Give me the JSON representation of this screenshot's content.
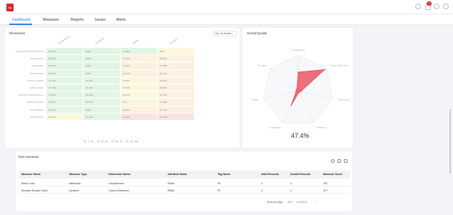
{
  "header": {
    "logo_text": "DQ",
    "notification_count": "3"
  },
  "tabs": [
    {
      "label": "Dashboard"
    },
    {
      "label": "Measures"
    },
    {
      "label": "Reports"
    },
    {
      "label": "Issues"
    },
    {
      "label": "Alerts"
    }
  ],
  "dimensions_card": {
    "title": "Dimensions",
    "select_value": "Top 10 Assets",
    "columns": [
      "Completeness",
      "Conformity",
      "Validity",
      "Accuracy"
    ],
    "rows": [
      {
        "label": "BANKEXPOSUREPOSITION",
        "values": [
          "96.09%",
          "100%",
          "76.59%",
          "68%"
        ]
      },
      {
        "label": "BANKLOANS",
        "values": [
          "86.58%",
          "100%",
          "41.18%",
          "38.55%"
        ]
      },
      {
        "label": "BRANCHES",
        "values": [
          "86.59%",
          "100%",
          "41.18%",
          "41.65%"
        ]
      },
      {
        "label": "BRANCHES2",
        "values": [
          "88.57%",
          "100%",
          "42.12%",
          "40.21%"
        ]
      },
      {
        "label": "LOANS_ORDER",
        "values": [
          "79.74%",
          "96.32%",
          "74.59%",
          "38.15%"
        ]
      },
      {
        "label": "EMPLOYEES",
        "values": [
          "77.74%",
          "96.32%",
          "72.50%",
          "38.85%"
        ]
      },
      {
        "label": "MORTGAGEPORTFOLIO",
        "values": [
          "79.82%",
          "95.90%",
          "50.00%",
          "31.45%"
        ]
      },
      {
        "label": "TRANSACTIONS",
        "values": [
          "79.82%",
          "95.92%",
          "57%",
          "27.50%"
        ]
      },
      {
        "label": "CUSTOMERS",
        "values": [
          "78.73%",
          "100%",
          "49.80%",
          "25.10%"
        ]
      },
      {
        "label": "PORTFOLIOS",
        "values": [
          "64.44%",
          "97.45%",
          "19.23%",
          "15.72%"
        ]
      }
    ],
    "legend": [
      {
        "label": "0 - 25",
        "color": "#fbe3e3"
      },
      {
        "label": "25 - 50",
        "color": "#fdf0e0"
      },
      {
        "label": "50 - 75",
        "color": "#fbf7df"
      },
      {
        "label": "75 - 100",
        "color": "#e2f5e4"
      }
    ]
  },
  "quality_card": {
    "title": "Overall Quality",
    "value": "47.4%",
    "axes": [
      "Completeness",
      "Custom Dimension",
      "Consistency",
      "Timeliness",
      "Uniqueness",
      "Validity",
      "Accuracy"
    ],
    "scores": [
      0.52,
      0.95,
      0.08,
      0.05,
      0.45,
      0.06,
      0.05
    ],
    "accent": "#e8414d"
  },
  "rules_card": {
    "title": "Rule Summary",
    "columns": [
      "Measure Name",
      "Measure Type",
      "Dimension Name",
      "Attribute Name",
      "Tag Name",
      "Valid Records",
      "Invalid Records",
      "Measure Score"
    ],
    "rows": [
      [
        "Blank Count",
        "distribution",
        "Completeness",
        "EMAIL",
        "PII",
        "4",
        "4",
        "100"
      ],
      [
        "Business Domain Check",
        "semantic",
        "Custom Dimension",
        "EMAIL",
        "PII",
        "4",
        "4",
        "29.7"
      ]
    ],
    "pager": {
      "rows_label": "Rows per page:",
      "rows_value": "10",
      "range": "1-10 of 12"
    }
  }
}
